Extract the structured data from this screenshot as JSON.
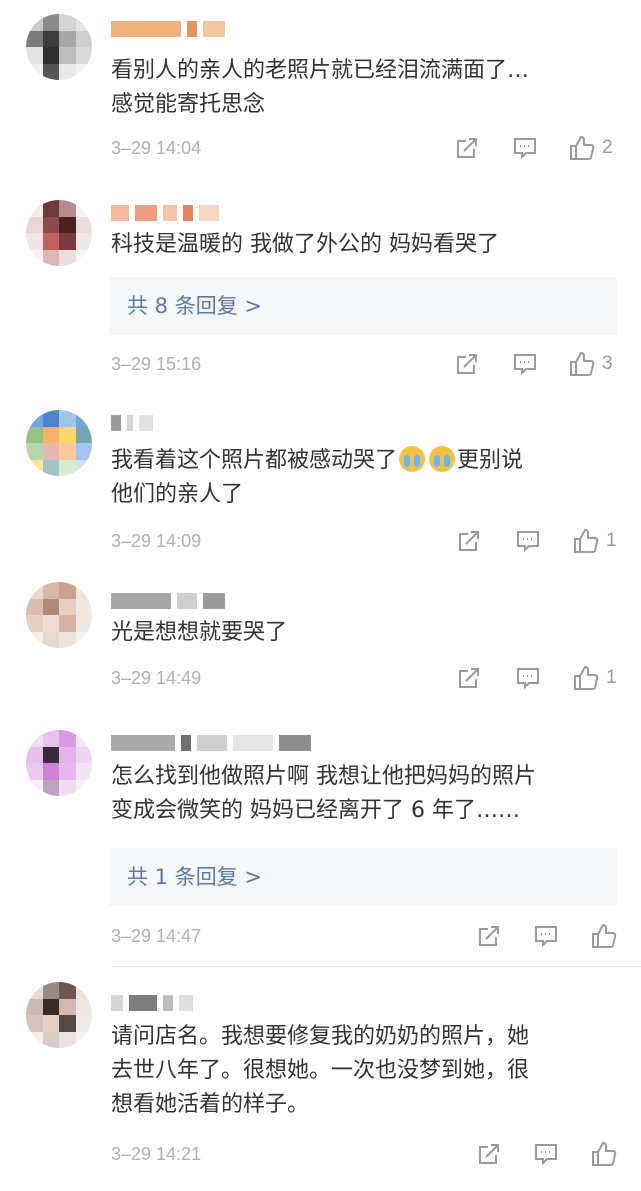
{
  "comments": [
    {
      "text": "看别人的亲人的老照片就已经泪流满面了…\n感觉能寄托思念",
      "time": "3–29 14:04",
      "likes": "2",
      "reply": ""
    },
    {
      "text": "科技是温暖的 我做了外公的 妈妈看哭了",
      "time": "3–29 15:16",
      "likes": "3",
      "reply": "共 8 条回复 >"
    },
    {
      "text_before_emoji": "我看着这个照片都被感动哭了",
      "text_after_emoji": "更别说\n他们的亲人了",
      "emoji": "crying-face",
      "time": "3–29 14:09",
      "likes": "1",
      "reply": ""
    },
    {
      "text": "光是想想就要哭了",
      "time": "3–29 14:49",
      "likes": "1",
      "reply": ""
    },
    {
      "text": "怎么找到他做照片啊 我想让他把妈妈的照片\n变成会微笑的 妈妈已经离开了 6 年了……",
      "time": "3–29 14:47",
      "likes": "",
      "reply": "共 1 条回复 >"
    },
    {
      "text": "请问店名。我想要修复我的奶奶的照片，她\n去世八年了。很想她。一次也没梦到她，很\n想看她活着的样子。",
      "time": "3–29 14:21",
      "likes": "",
      "reply": ""
    }
  ],
  "colors": {
    "reply_link": "#5b79a6",
    "reply_bg": "#f5f6f8",
    "meta_gray": "#b0b0b0",
    "emoji_yellow": "#f7c244"
  },
  "icons": [
    "share-icon",
    "comment-icon",
    "like-icon"
  ]
}
